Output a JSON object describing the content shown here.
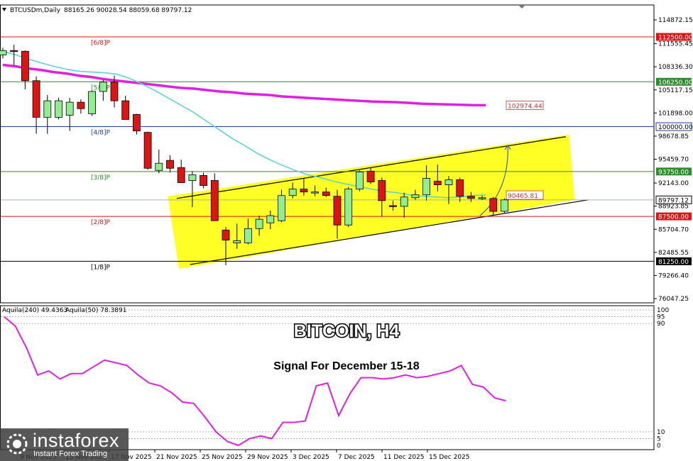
{
  "header": {
    "symbol": "BTCUSDm,Daily",
    "ohlc": "88165.26 90028.54 88059.68 89797.12"
  },
  "indicator": {
    "label1": "Aquila(240) 49.4363",
    "label2": "Aquila(50) 78.3891",
    "scale": [
      "100",
      "95",
      "90",
      "10",
      "5",
      "0"
    ]
  },
  "title": "BITCOIN, H4",
  "subtitle": "Signal For December 15-18",
  "logo": {
    "name": "instaforex",
    "tagline": "Instant Forex Trading"
  },
  "colors": {
    "bull": "#90ee90",
    "bear": "#dc1414",
    "ma_long": "#e020e0",
    "ma_short": "#5fd3d3",
    "channel": "#ffff1a",
    "res": "#dc1414",
    "sup": "#2e8b2e"
  },
  "chart_data": {
    "type": "candlestick",
    "y_ticks": [
      "114872.15",
      "111555.45",
      "108336.30",
      "105117.15",
      "101898.00",
      "98678.85",
      "95459.70",
      "92143.00",
      "88923.85",
      "85704.70",
      "82485.55",
      "79266.40",
      "76047.25"
    ],
    "x_ticks": [
      "9 Nov 2025",
      "13 Nov 2025",
      "17 Nov 2025",
      "21 Nov 2025",
      "25 Nov 2025",
      "29 Nov 2025",
      "3 Dec 2025",
      "7 Dec 2025",
      "11 Dec 2025",
      "15 Dec 2025"
    ],
    "ylim": [
      76047.25,
      114872.15
    ],
    "levels": [
      {
        "name": "[6/8]P",
        "price": 112500,
        "tag": "112500.00",
        "color": "red"
      },
      {
        "name": "[5/8]P",
        "price": 106250,
        "tag": "106250.00",
        "color": "green"
      },
      {
        "name": "[4/8]P",
        "price": 100000,
        "tag": "100000.00",
        "color": "blue"
      },
      {
        "name": "[3/8]P",
        "price": 93750,
        "tag": "93750.00",
        "color": "green"
      },
      {
        "name": "[2/8]P",
        "price": 87500,
        "tag": "87500.00",
        "color": "red"
      },
      {
        "name": "[1/8]P",
        "price": 81250,
        "tag": "81250.00",
        "color": "black"
      }
    ],
    "current_price": {
      "value": 89797.12,
      "tag": "89797.12"
    },
    "annotations": [
      {
        "text": "102974.44",
        "price": 102974.44
      },
      {
        "text": "90465.81",
        "price": 90465.81
      }
    ],
    "candles": [
      {
        "o": 110000,
        "h": 111000,
        "l": 109500,
        "c": 110600
      },
      {
        "o": 110600,
        "h": 111400,
        "l": 108500,
        "c": 110500
      },
      {
        "o": 110500,
        "h": 110600,
        "l": 105200,
        "c": 106400
      },
      {
        "o": 106400,
        "h": 107000,
        "l": 99000,
        "c": 101300
      },
      {
        "o": 101300,
        "h": 104400,
        "l": 99000,
        "c": 103600
      },
      {
        "o": 101300,
        "h": 104000,
        "l": 101000,
        "c": 103600
      },
      {
        "o": 101600,
        "h": 104000,
        "l": 99400,
        "c": 103400
      },
      {
        "o": 103400,
        "h": 103800,
        "l": 101800,
        "c": 102500
      },
      {
        "o": 101800,
        "h": 105000,
        "l": 101500,
        "c": 104900
      },
      {
        "o": 104900,
        "h": 106500,
        "l": 103600,
        "c": 106200
      },
      {
        "o": 106200,
        "h": 107100,
        "l": 102700,
        "c": 103600
      },
      {
        "o": 103600,
        "h": 104300,
        "l": 101000,
        "c": 101000
      },
      {
        "o": 101700,
        "h": 101800,
        "l": 98900,
        "c": 99400
      },
      {
        "o": 99200,
        "h": 99300,
        "l": 94000,
        "c": 94200
      },
      {
        "o": 93900,
        "h": 96800,
        "l": 93500,
        "c": 94900
      },
      {
        "o": 95300,
        "h": 96000,
        "l": 93600,
        "c": 94200
      },
      {
        "o": 94300,
        "h": 95400,
        "l": 92400,
        "c": 92200
      },
      {
        "o": 92500,
        "h": 93800,
        "l": 88800,
        "c": 93300
      },
      {
        "o": 93200,
        "h": 93600,
        "l": 91400,
        "c": 91800
      },
      {
        "o": 92500,
        "h": 93500,
        "l": 88500,
        "c": 86900
      },
      {
        "o": 85600,
        "h": 86000,
        "l": 80700,
        "c": 84200
      },
      {
        "o": 83800,
        "h": 86500,
        "l": 83000,
        "c": 84100
      },
      {
        "o": 83800,
        "h": 87200,
        "l": 83600,
        "c": 85800
      },
      {
        "o": 85800,
        "h": 87600,
        "l": 84800,
        "c": 87100
      },
      {
        "o": 86600,
        "h": 88300,
        "l": 85700,
        "c": 87600
      },
      {
        "o": 86900,
        "h": 91200,
        "l": 86700,
        "c": 90400
      },
      {
        "o": 90400,
        "h": 92200,
        "l": 90000,
        "c": 91300
      },
      {
        "o": 91300,
        "h": 92800,
        "l": 90400,
        "c": 90900
      },
      {
        "o": 90900,
        "h": 91800,
        "l": 90300,
        "c": 90900
      },
      {
        "o": 90900,
        "h": 91500,
        "l": 90200,
        "c": 90400
      },
      {
        "o": 90300,
        "h": 91200,
        "l": 84400,
        "c": 86300
      },
      {
        "o": 86300,
        "h": 91600,
        "l": 86000,
        "c": 91300
      },
      {
        "o": 91300,
        "h": 93900,
        "l": 91000,
        "c": 93700
      },
      {
        "o": 93800,
        "h": 94300,
        "l": 92000,
        "c": 92300
      },
      {
        "o": 92500,
        "h": 92900,
        "l": 87500,
        "c": 89700
      },
      {
        "o": 89000,
        "h": 89700,
        "l": 88300,
        "c": 88900
      },
      {
        "o": 88900,
        "h": 90800,
        "l": 87300,
        "c": 90200
      },
      {
        "o": 90100,
        "h": 91200,
        "l": 89800,
        "c": 90500
      },
      {
        "o": 90500,
        "h": 94600,
        "l": 89700,
        "c": 92800
      },
      {
        "o": 92400,
        "h": 94700,
        "l": 91000,
        "c": 91900
      },
      {
        "o": 91900,
        "h": 93100,
        "l": 89200,
        "c": 92600
      },
      {
        "o": 92600,
        "h": 92900,
        "l": 89500,
        "c": 90300
      },
      {
        "o": 90300,
        "h": 90900,
        "l": 89500,
        "c": 90000
      },
      {
        "o": 90000,
        "h": 90400,
        "l": 89800,
        "c": 90100
      },
      {
        "o": 90000,
        "h": 90200,
        "l": 87600,
        "c": 88200
      },
      {
        "o": 88200,
        "h": 90000,
        "l": 88000,
        "c": 89800
      }
    ],
    "ma_long": [
      108600,
      108400,
      108100,
      107900,
      107600,
      107400,
      107100,
      106900,
      106600,
      106400,
      106200,
      106000,
      105800,
      105600,
      105400,
      105300,
      105100,
      104900,
      104800,
      104600,
      104500,
      104400,
      104200,
      104100,
      104000,
      103900,
      103800,
      103700,
      103600,
      103500,
      103450,
      103400,
      103300,
      103200,
      103150,
      103100,
      103050,
      103000,
      102974.44
    ],
    "ma_short": [
      110500,
      110000,
      109400,
      108900,
      108400,
      108000,
      107700,
      107600,
      107500,
      107300,
      106700,
      105900,
      105000,
      104000,
      103000,
      102000,
      100800,
      99600,
      98400,
      97400,
      96300,
      95400,
      94600,
      93900,
      93300,
      92900,
      92400,
      92000,
      91700,
      91300,
      91000,
      90800,
      90500,
      90300,
      90200,
      90100,
      90200,
      90400,
      90465.81
    ],
    "channel": {
      "upper": [
        {
          "i": 15.6,
          "p": 90000
        },
        {
          "i": 50.5,
          "p": 98600
        }
      ],
      "lower": [
        {
          "i": 16.8,
          "p": 80800
        },
        {
          "i": 52.5,
          "p": 89800
        }
      ],
      "box": [
        {
          "i": 14.8,
          "p": 90300
        },
        {
          "i": 50.8,
          "p": 98900
        },
        {
          "i": 51.3,
          "p": 89800
        },
        {
          "i": 15.8,
          "p": 80200
        }
      ]
    },
    "arrow": {
      "from": {
        "i": 42.8,
        "p": 87600
      },
      "to": {
        "i": 45.3,
        "p": 97400
      }
    },
    "indicator_series": {
      "ylim": [
        0,
        100
      ],
      "values": [
        95,
        88,
        72,
        52,
        55,
        49,
        53,
        53,
        58,
        63,
        61,
        59,
        52,
        46,
        44,
        39,
        32,
        31,
        21,
        10,
        3,
        0,
        5,
        7,
        5,
        17,
        17,
        18,
        44,
        46,
        22,
        38,
        50,
        50,
        49,
        50,
        52,
        50,
        51,
        53,
        55,
        59,
        45,
        43,
        35,
        33
      ]
    }
  }
}
